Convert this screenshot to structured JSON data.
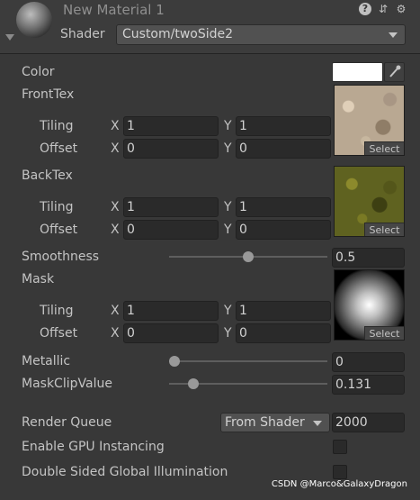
{
  "header": {
    "title": "New Material 1",
    "icons": [
      "help-icon",
      "settings-sliders-icon",
      "gear-icon",
      "fold-arrow-icon"
    ],
    "shader_label": "Shader",
    "shader_value": "Custom/twoSide2"
  },
  "properties": {
    "color": {
      "label": "Color",
      "value": "#FFFFFF"
    },
    "front_tex": {
      "label": "FrontTex",
      "tiling_label": "Tiling",
      "offset_label": "Offset",
      "tiling_x": "1",
      "tiling_y": "1",
      "offset_x": "0",
      "offset_y": "0",
      "select_label": "Select"
    },
    "back_tex": {
      "label": "BackTex",
      "tiling_label": "Tiling",
      "offset_label": "Offset",
      "tiling_x": "1",
      "tiling_y": "1",
      "offset_x": "0",
      "offset_y": "0",
      "select_label": "Select"
    },
    "smoothness": {
      "label": "Smoothness",
      "value": "0.5",
      "fraction": 0.5
    },
    "mask": {
      "label": "Mask",
      "tiling_label": "Tiling",
      "offset_label": "Offset",
      "tiling_x": "1",
      "tiling_y": "1",
      "offset_x": "0",
      "offset_y": "0",
      "select_label": "Select"
    },
    "metallic": {
      "label": "Metallic",
      "value": "0",
      "fraction": 0.0
    },
    "mask_clip_value": {
      "label": "MaskClipValue",
      "value": "0.131",
      "fraction": 0.131
    }
  },
  "render_queue": {
    "label": "Render Queue",
    "mode": "From Shader",
    "value": "2000"
  },
  "gpu_instancing": {
    "label": "Enable GPU Instancing",
    "checked": false
  },
  "double_sided_gi": {
    "label": "Double Sided Global Illumination",
    "checked": false
  },
  "axis_labels": {
    "x": "X",
    "y": "Y"
  },
  "watermark": "CSDN @Marco&GalaxyDragon",
  "colors": {
    "panel": "#383838",
    "field": "#2a2a2a",
    "text": "#c4c4c4"
  }
}
